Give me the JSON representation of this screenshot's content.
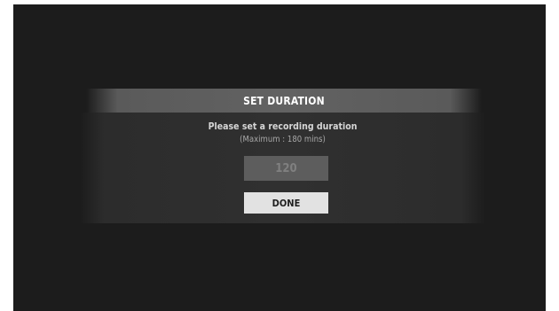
{
  "dialog": {
    "title": "SET DURATION",
    "prompt": "Please set a recording duration",
    "hint": "(Maximum : 180 mins)",
    "duration_value": "120",
    "done_label": "DONE"
  },
  "colors": {
    "screen_background": "#1c1c1c",
    "header_background": "#626262",
    "body_background": "#303030",
    "field_background": "#5d5d5d",
    "button_background": "#e2e2e2"
  }
}
